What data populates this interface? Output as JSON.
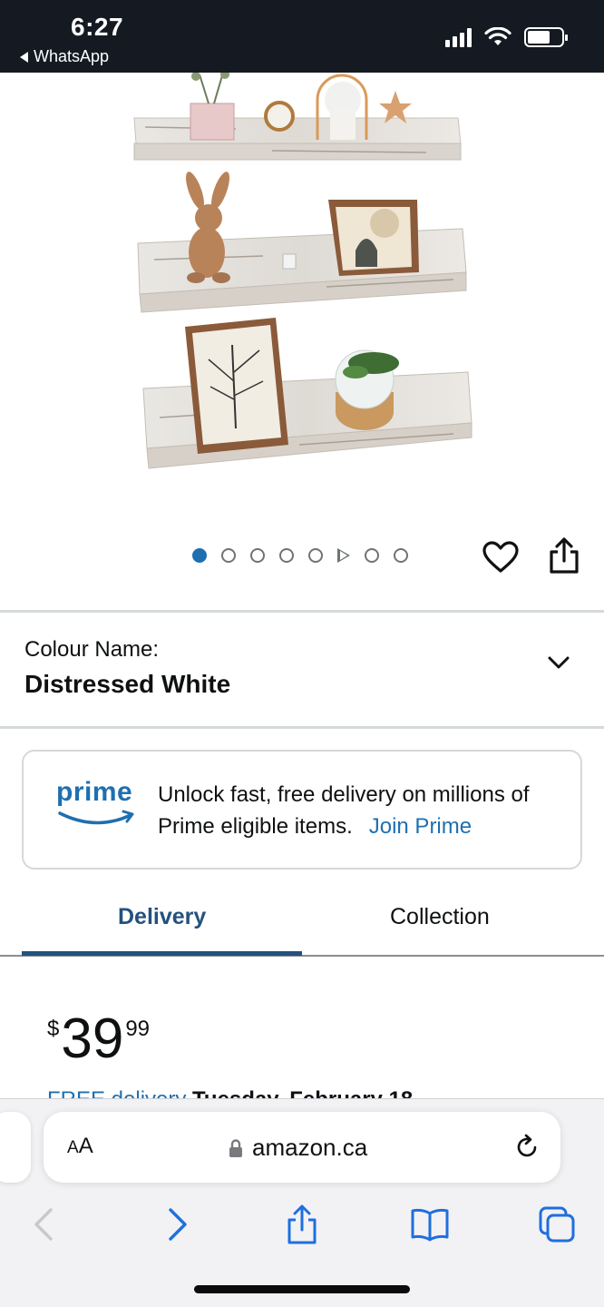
{
  "status_bar": {
    "time": "6:27",
    "back_app": "WhatsApp",
    "icons": [
      "signal-icon",
      "wifi-icon",
      "battery-icon"
    ]
  },
  "product_image": {
    "description_icon": "floating-shelves-photo",
    "carousel": {
      "total_items": 8,
      "active_index": 0,
      "video_index": 5
    }
  },
  "actions": {
    "icons": [
      "heart-icon",
      "share-icon"
    ]
  },
  "colour": {
    "label": "Colour Name:",
    "value": "Distressed White"
  },
  "prime": {
    "logo_text": "prime",
    "message": "Unlock fast, free delivery on millions of Prime eligible items.",
    "link": "Join Prime"
  },
  "tabs": [
    {
      "label": "Delivery",
      "selected": true
    },
    {
      "label": "Collection",
      "selected": false
    }
  ],
  "price": {
    "currency": "$",
    "whole": "39",
    "fraction": "99"
  },
  "delivery_peek": {
    "free_text": "FREE delivery",
    "date_text": "Tuesday, February 18"
  },
  "safari": {
    "text_size_label": "AA",
    "url": "amazon.ca",
    "toolbar": [
      "back-icon",
      "forward-icon",
      "share-icon",
      "bookmarks-icon",
      "tabs-icon"
    ]
  },
  "colors": {
    "accent_blue": "#1f6fb0",
    "tab_blue": "#24517e",
    "status_bar_bg": "#151a22"
  }
}
